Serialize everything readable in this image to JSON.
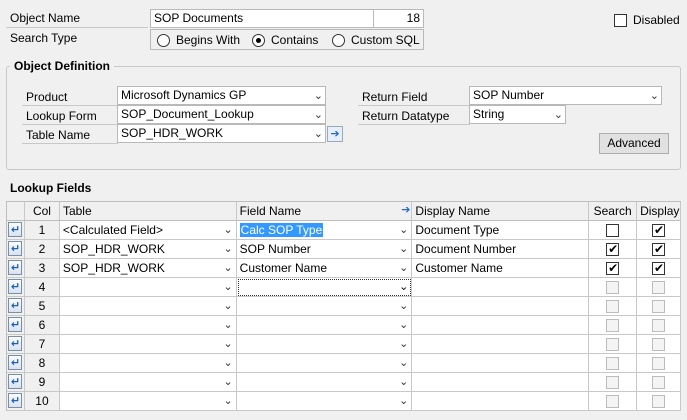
{
  "header": {
    "object_name_label": "Object Name",
    "object_name_value": "SOP Documents",
    "object_id": "18",
    "search_type_label": "Search Type",
    "search_options": [
      {
        "label": "Begins With",
        "selected": false
      },
      {
        "label": "Contains",
        "selected": true
      },
      {
        "label": "Custom SQL",
        "selected": false
      }
    ],
    "disabled_label": "Disabled",
    "disabled_checked": false
  },
  "definition": {
    "title": "Object Definition",
    "product_label": "Product",
    "product_value": "Microsoft Dynamics GP",
    "lookup_form_label": "Lookup Form",
    "lookup_form_value": "SOP_Document_Lookup",
    "table_name_label": "Table Name",
    "table_name_value": "SOP_HDR_WORK",
    "return_field_label": "Return Field",
    "return_field_value": "SOP Number",
    "return_datatype_label": "Return Datatype",
    "return_datatype_value": "String",
    "advanced_label": "Advanced"
  },
  "lookup": {
    "title": "Lookup Fields",
    "columns": {
      "col": "Col",
      "table": "Table",
      "field_name": "Field Name",
      "display_name": "Display Name",
      "search": "Search",
      "display": "Display"
    },
    "rows": [
      {
        "col": "1",
        "table": "<Calculated Field>",
        "field": "Calc SOP Type",
        "display_name": "Document Type",
        "search": false,
        "display": true,
        "enabled": true
      },
      {
        "col": "2",
        "table": "SOP_HDR_WORK",
        "field": "SOP Number",
        "display_name": "Document Number",
        "search": true,
        "display": true,
        "enabled": true
      },
      {
        "col": "3",
        "table": "SOP_HDR_WORK",
        "field": "Customer Name",
        "display_name": "Customer Name",
        "search": true,
        "display": true,
        "enabled": true
      },
      {
        "col": "4",
        "table": "",
        "field": "",
        "display_name": "",
        "search": false,
        "display": false,
        "enabled": false
      },
      {
        "col": "5",
        "table": "",
        "field": "",
        "display_name": "",
        "search": false,
        "display": false,
        "enabled": false
      },
      {
        "col": "6",
        "table": "",
        "field": "",
        "display_name": "",
        "search": false,
        "display": false,
        "enabled": false
      },
      {
        "col": "7",
        "table": "",
        "field": "",
        "display_name": "",
        "search": false,
        "display": false,
        "enabled": false
      },
      {
        "col": "8",
        "table": "",
        "field": "",
        "display_name": "",
        "search": false,
        "display": false,
        "enabled": false
      },
      {
        "col": "9",
        "table": "",
        "field": "",
        "display_name": "",
        "search": false,
        "display": false,
        "enabled": false
      },
      {
        "col": "10",
        "table": "",
        "field": "",
        "display_name": "",
        "search": false,
        "display": false,
        "enabled": false
      }
    ]
  },
  "icons": {
    "row_icon": "row-expand-icon",
    "arrow": "arrow-right-icon",
    "chevron": "chevron-down-icon"
  }
}
